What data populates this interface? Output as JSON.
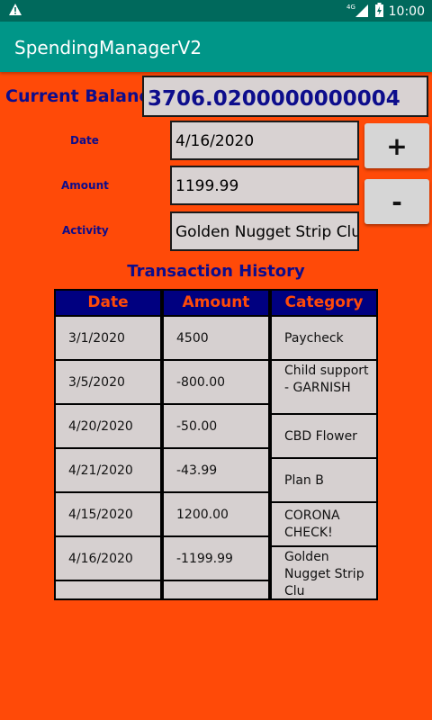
{
  "status_bar": {
    "time": "10:00",
    "network": "4G"
  },
  "app": {
    "title": "SpendingManagerV2"
  },
  "balance": {
    "label": "Current Balance:",
    "value": "3706.0200000000004"
  },
  "form": {
    "date_label": "Date",
    "date_value": "4/16/2020",
    "amount_label": "Amount",
    "amount_value": "1199.99",
    "activity_label": "Activity",
    "activity_value": "Golden Nugget Strip Clu"
  },
  "buttons": {
    "add": "+",
    "subtract": "-"
  },
  "history": {
    "title": "Transaction History",
    "headers": [
      "Date",
      "Amount",
      "Category"
    ],
    "dates": [
      "3/1/2020",
      "3/5/2020",
      "4/20/2020",
      "4/21/2020",
      "4/15/2020",
      "4/16/2020"
    ],
    "amounts": [
      "4500",
      "-800.00",
      "-50.00",
      "-43.99",
      "1200.00",
      "-1199.99"
    ],
    "categories": [
      "Paycheck",
      "Child support - GARNISH",
      "CBD Flower",
      "Plan B",
      "CORONA CHECK!",
      "Golden Nugget Strip Clu"
    ]
  },
  "colors": {
    "background": "#ff4a08",
    "appbar": "#009688",
    "statusbar": "#00695c",
    "label_text": "#0d0d8c",
    "table_header": "#000080",
    "cell": "#d6d0d0"
  }
}
